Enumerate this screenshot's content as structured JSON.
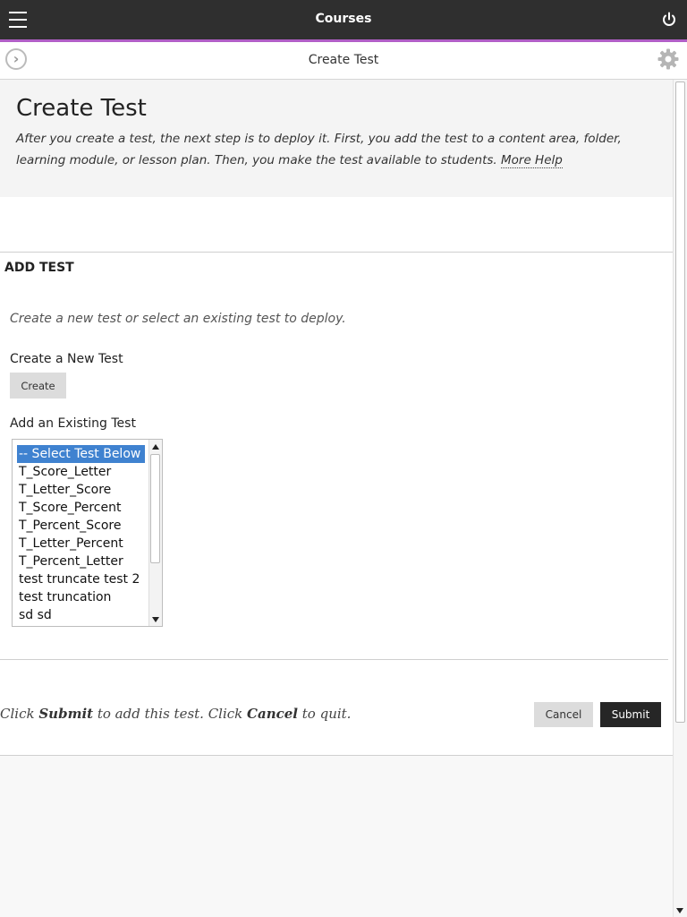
{
  "topbar": {
    "title": "Courses",
    "menu_icon": "hamburger-menu-icon",
    "logout_icon": "power-icon",
    "accent_color": "#b15fc7"
  },
  "subbar": {
    "title": "Create Test",
    "back_icon": "chevron-right-circle-icon",
    "settings_icon": "gear-icon"
  },
  "header": {
    "title": "Create Test",
    "instructions": "After you create a test, the next step is to deploy it. First, you add the test to a content area, folder, learning module, or lesson plan. Then, you make the test available to students.",
    "help_link": "More Help"
  },
  "section": {
    "title": "ADD TEST",
    "hint": "Create a new test or select an existing test to deploy.",
    "new_label": "Create a New Test",
    "create_button": "Create",
    "existing_label": "Add an Existing Test",
    "options": [
      "-- Select Test Below --",
      "T_Score_Letter",
      "T_Letter_Score",
      "T_Score_Percent",
      "T_Percent_Score",
      "T_Letter_Percent",
      "T_Percent_Letter",
      "test truncate test 2",
      "test truncation",
      "sd sd"
    ],
    "selected_option": "-- Select Test Below --",
    "selection_color": "#3f82d0"
  },
  "footer": {
    "text_click1": "Click ",
    "text_submit": "Submit",
    "text_mid": " to add this test. Click ",
    "text_cancel": "Cancel",
    "text_end": " to quit.",
    "cancel_button": "Cancel",
    "submit_button": "Submit"
  }
}
